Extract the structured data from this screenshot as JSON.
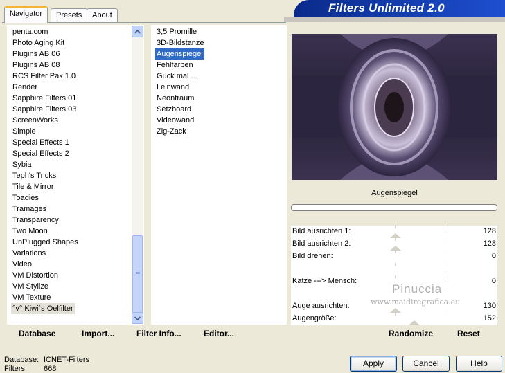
{
  "tabs": [
    {
      "label": "Navigator",
      "active": true
    },
    {
      "label": "Presets",
      "active": false
    },
    {
      "label": "About",
      "active": false
    }
  ],
  "banner": {
    "title": "Filters Unlimited 2.0"
  },
  "categories": {
    "items": [
      "penta.com",
      "Photo Aging Kit",
      "Plugins AB 06",
      "Plugins AB 08",
      "RCS Filter Pak 1.0",
      "Render",
      "Sapphire Filters 01",
      "Sapphire Filters 03",
      "ScreenWorks",
      "Simple",
      "Special Effects 1",
      "Special Effects 2",
      "Sybia",
      "Teph's Tricks",
      "Tile & Mirror",
      "Toadies",
      "Tramages",
      "Transparency",
      "Two Moon",
      "UnPlugged Shapes",
      "Variations",
      "Video",
      "VM Distortion",
      "VM Stylize",
      "VM Texture",
      "°v° Kiwi`s Oelfilter"
    ],
    "selected_index": 25
  },
  "filters": {
    "items": [
      "3,5 Promille",
      "3D-Bildstanze",
      "Augenspiegel",
      "Fehlfarben",
      "Guck mal ...",
      "Leinwand",
      "Neontraum",
      "Setzboard",
      "Videowand",
      "Zig-Zack"
    ],
    "selected_index": 2
  },
  "filter_name": "Augenspiegel",
  "sliders": [
    {
      "label": "Bild ausrichten 1:",
      "value": "128",
      "has_thumb": true
    },
    {
      "label": "Bild ausrichten 2:",
      "value": "128",
      "has_thumb": true
    },
    {
      "label": "Bild drehen:",
      "value": "0",
      "has_thumb": false
    },
    {
      "label": "",
      "value": "",
      "has_thumb": false
    },
    {
      "label": "Katze ---> Mensch:",
      "value": "0",
      "has_thumb": false
    },
    {
      "label": "",
      "value": "",
      "has_thumb": false
    },
    {
      "label": "Auge ausrichten:",
      "value": "130",
      "has_thumb": true
    },
    {
      "label": "Augengröße:",
      "value": "152",
      "has_thumb": true
    }
  ],
  "bottom_bar": {
    "database": "Database",
    "import": "Import...",
    "filter_info": "Filter Info...",
    "editor": "Editor...",
    "randomize": "Randomize",
    "reset": "Reset"
  },
  "watermark": {
    "line1": "Pinuccia",
    "line2": "www.maidiregrafica.eu"
  },
  "status": {
    "database_label": "Database:",
    "database_value": "ICNET-Filters",
    "filters_label": "Filters:",
    "filters_value": "668"
  },
  "buttons": {
    "apply": "Apply",
    "cancel": "Cancel",
    "help": "Help"
  },
  "colors": {
    "selection_blue": "#316ac5",
    "banner_blue": "#1e4fd0",
    "face": "#ece9d8"
  }
}
